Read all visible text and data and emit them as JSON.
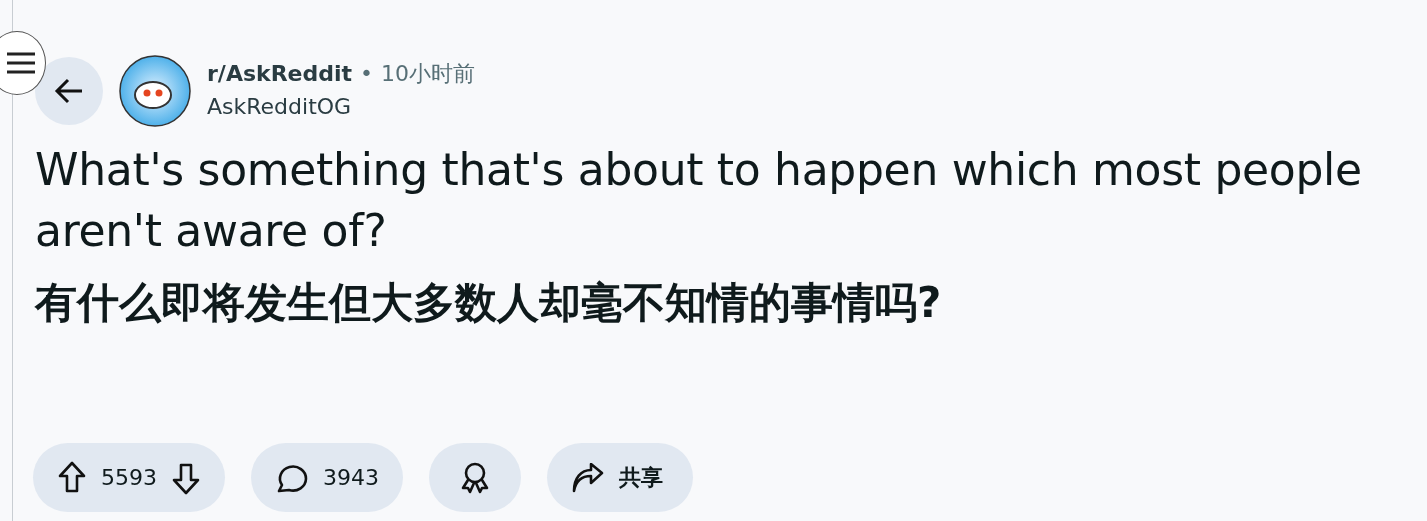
{
  "post": {
    "subreddit": "r/AskReddit",
    "separator": "•",
    "time": "10小时前",
    "author": "AskRedditOG",
    "title": "What's something that's about to happen which most people aren't aware of?",
    "translation": "有什么即将发生但大多数人却毫不知情的事情吗?"
  },
  "actions": [
    {
      "kind": "vote",
      "count": "5593"
    },
    {
      "kind": "comment",
      "count": "3943"
    },
    {
      "kind": "award"
    },
    {
      "kind": "share",
      "label": "共享"
    }
  ]
}
